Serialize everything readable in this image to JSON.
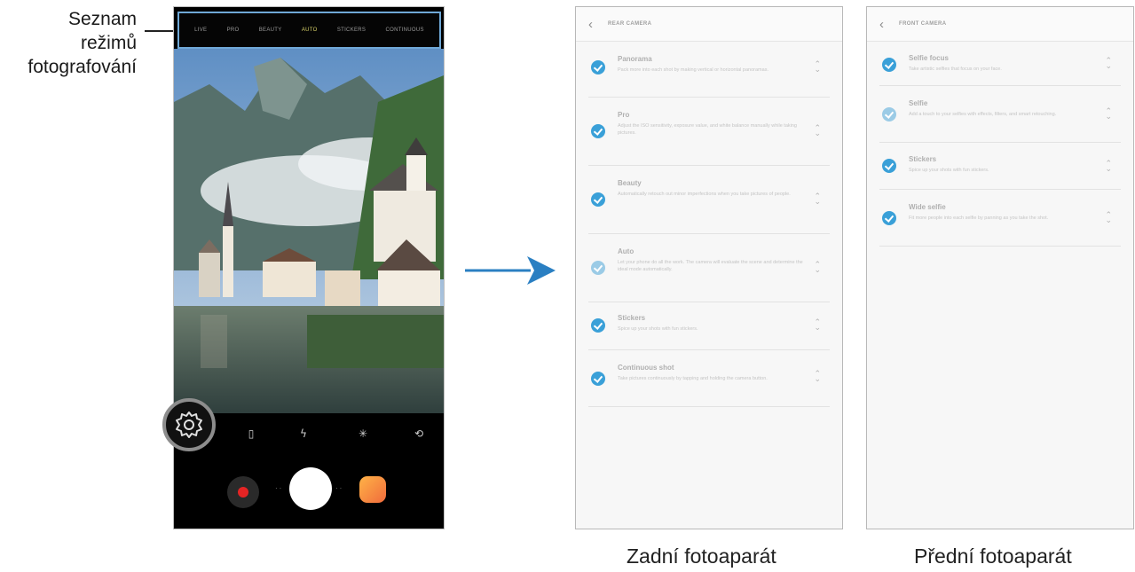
{
  "annotation": {
    "line1": "Seznam",
    "line2": "režimů",
    "line3": "fotografování"
  },
  "phone": {
    "modes": [
      "LIVE",
      "PRO",
      "BEAUTY",
      "AUTO",
      "STICKERS",
      "CONTINUOUS"
    ],
    "active_mode": "AUTO",
    "toolbar_icons": [
      "settings-icon",
      "aspect-ratio-icon",
      "flash-off-icon",
      "effects-icon",
      "switch-camera-icon"
    ]
  },
  "rear_panel": {
    "title": "REAR CAMERA",
    "back_glyph": "‹",
    "items": [
      {
        "title": "Panorama",
        "desc": "Pack more into each shot by making vertical or horizontal panoramas."
      },
      {
        "title": "Pro",
        "desc": "Adjust the ISO sensitivity, exposure value, and white balance manually while taking pictures."
      },
      {
        "title": "Beauty",
        "desc": "Automatically retouch out minor imperfections when you take pictures of people."
      },
      {
        "title": "Auto",
        "desc": "Let your phone do all the work. The camera will evaluate the scene and determine the ideal mode automatically."
      },
      {
        "title": "Stickers",
        "desc": "Spice up your shots with fun stickers."
      },
      {
        "title": "Continuous shot",
        "desc": "Take pictures continuously by tapping and holding the camera button."
      }
    ]
  },
  "front_panel": {
    "title": "FRONT CAMERA",
    "back_glyph": "‹",
    "items": [
      {
        "title": "Selfie focus",
        "desc": "Take artistic selfies that focus on your face."
      },
      {
        "title": "Selfie",
        "desc": "Add a touch to your selfies with effects, filters, and smart retouching."
      },
      {
        "title": "Stickers",
        "desc": "Spice up your shots with fun stickers."
      },
      {
        "title": "Wide selfie",
        "desc": "Fit more people into each selfie by panning as you take the shot."
      }
    ]
  },
  "captions": {
    "rear": "Zadní fotoaparát",
    "front": "Přední fotoaparát"
  },
  "colors": {
    "accent_check": "#3aa0d8",
    "arrow": "#2a7fc2",
    "record": "#e52424",
    "mode_bar_border": "#6fa8d6"
  }
}
